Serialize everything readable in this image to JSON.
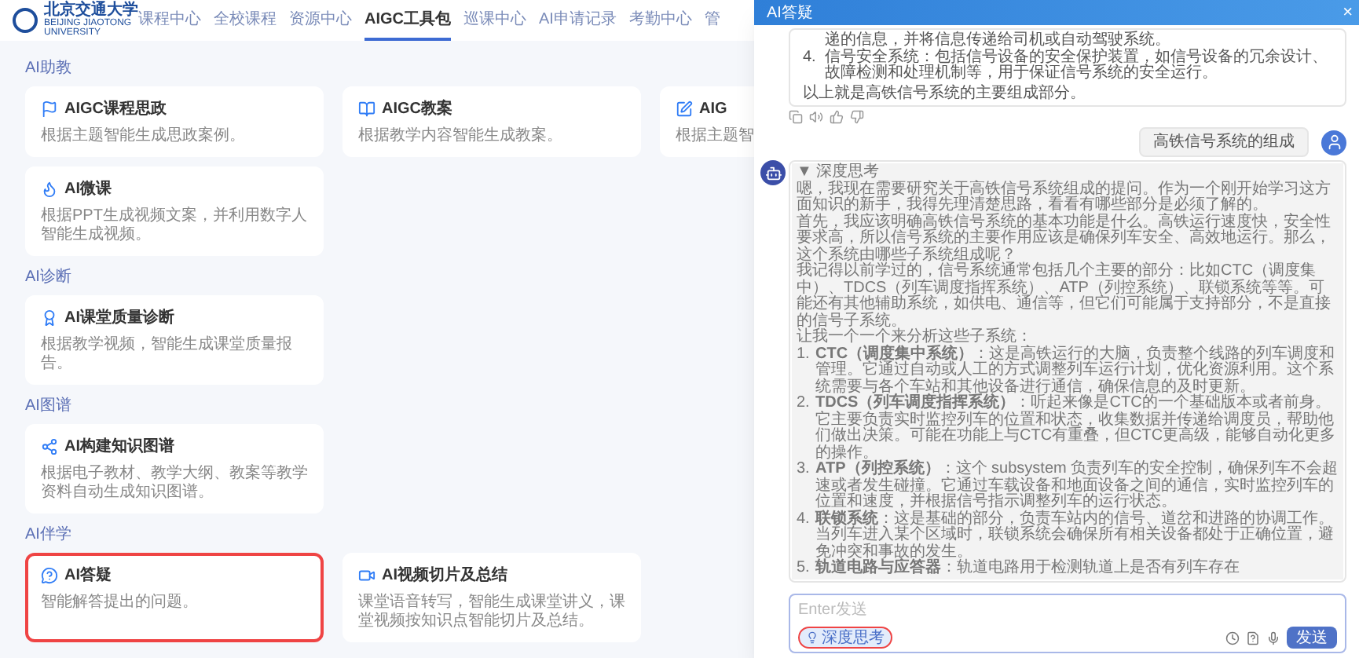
{
  "nav": {
    "logo_text": "北京交通大学",
    "logo_subtext": "BEIJING JIAOTONG UNIVERSITY",
    "items": [
      {
        "label": "课程中心",
        "selected": false
      },
      {
        "label": "全校课程",
        "selected": false
      },
      {
        "label": "资源中心",
        "selected": false
      },
      {
        "label": "AIGC工具包",
        "selected": true
      },
      {
        "label": "巡课中心",
        "selected": false
      },
      {
        "label": "AI申请记录",
        "selected": false
      },
      {
        "label": "考勤中心",
        "selected": false
      },
      {
        "label": "管",
        "selected": false
      }
    ]
  },
  "sections": [
    {
      "title": "AI助教",
      "cards": [
        {
          "title": "AIGC课程思政",
          "description": "根据主题智能生成思政案例。",
          "highlighted": false
        },
        {
          "title": "AIGC教案",
          "description": "根据教学内容智能生成教案。",
          "highlighted": false
        },
        {
          "title": "AIG",
          "description": "根据主题智",
          "highlighted": false
        },
        {
          "title": "AI微课",
          "description": "根据PPT生成视频文案，并利用数字人智能生成视频。",
          "highlighted": false
        }
      ]
    },
    {
      "title": "AI诊断",
      "cards": [
        {
          "title": "AI课堂质量诊断",
          "description": "根据教学视频，智能生成课堂质量报告。",
          "highlighted": false
        }
      ]
    },
    {
      "title": "AI图谱",
      "cards": [
        {
          "title": "AI构建知识图谱",
          "description": "根据电子教材、教学大纲、教案等教学资料自动生成知识图谱。",
          "highlighted": false
        }
      ]
    },
    {
      "title": "AI伴学",
      "cards": [
        {
          "title": "AI答疑",
          "description": "智能解答提出的问题。",
          "highlighted": true
        },
        {
          "title": "AI视频切片及总结",
          "description": "课堂语音转写，智能生成课堂讲义，课堂视频按知识点智能切片及总结。",
          "highlighted": false
        }
      ]
    }
  ],
  "dialog": {
    "title": "AI答疑",
    "close": "×",
    "previous_answer": {
      "continuation": "递的信息，并将信息传递给司机或自动驾驶系统。",
      "items": [
        {
          "number": "4.",
          "text": "信号安全系统：包括信号设备的安全保护装置，如信号设备的冗余设计、故障检测和处理机制等，用于保证信号系统的安全运行。"
        }
      ],
      "summary": "以上就是高铁信号系统的主要组成部分。"
    },
    "user_message": "高铁信号系统的组成",
    "thinking": {
      "label": "▼ 深度思考",
      "expanded": true,
      "paragraphs": [
        "嗯，我现在需要研究关于高铁信号系统组成的提问。作为一个刚开始学习这方面知识的新手，我得先理清楚思路，看看有哪些部分是必须了解的。",
        "首先，我应该明确高铁信号系统的基本功能是什么。高铁运行速度快，安全性要求高，所以信号系统的主要作用应该是确保列车安全、高效地运行。那么，这个系统由哪些子系统组成呢？",
        "我记得以前学过的，信号系统通常包括几个主要的部分：比如CTC（调度集中）、TDCS（列车调度指挥系统）、ATP（列控系统）、联锁系统等等。可能还有其他辅助系统，如供电、通信等，但它们可能属于支持部分，不是直接的信号子系统。",
        "让我一个一个来分析这些子系统："
      ],
      "items": [
        {
          "number": "1.",
          "text": "**CTC（调度集中系统）**：这是高铁运行的大脑，负责整个线路的列车调度和管理。它通过自动或人工的方式调整列车运行计划，优化资源利用。这个系统需要与各个车站和其他设备进行通信，确保信息的及时更新。"
        },
        {
          "number": "2.",
          "text": "**TDCS（列车调度指挥系统）**：听起来像是CTC的一个基础版本或者前身。它主要负责实时监控列车的位置和状态，收集数据并传递给调度员，帮助他们做出决策。可能在功能上与CTC有重叠，但CTC更高级，能够自动化更多的操作。"
        },
        {
          "number": "3.",
          "text": "**ATP（列控系统）**：这个 subsystem 负责列车的安全控制，确保列车不会超速或者发生碰撞。它通过车载设备和地面设备之间的通信，实时监控列车的位置和速度，并根据信号指示调整列车的运行状态。"
        },
        {
          "number": "4.",
          "text": "**联锁系统**：这是基础的部分，负责车站内的信号、道岔和进路的协调工作。当列车进入某个区域时，联锁系统会确保所有相关设备都处于正确位置，避免冲突和事故的发生。"
        },
        {
          "number": "5.",
          "text": "**轨道电路与应答器**：轨道电路用于检测轨道上是否有列车存在"
        }
      ]
    },
    "input": {
      "placeholder": "Enter发送",
      "deep_think": {
        "label": "深度思考",
        "selected": true,
        "highlighted": true
      },
      "send": "发送"
    }
  }
}
